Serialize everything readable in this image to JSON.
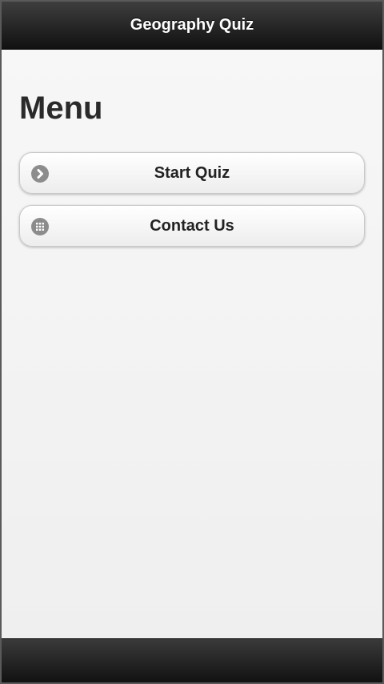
{
  "header": {
    "title": "Geography Quiz"
  },
  "page": {
    "title": "Menu"
  },
  "menu": {
    "items": [
      {
        "label": "Start Quiz",
        "icon": "arrow-right-icon"
      },
      {
        "label": "Contact Us",
        "icon": "grid-icon"
      }
    ]
  },
  "colors": {
    "header_bg": "#1a1a1a",
    "content_bg": "#f1f1f1",
    "icon_gray": "#8c8c8c"
  }
}
